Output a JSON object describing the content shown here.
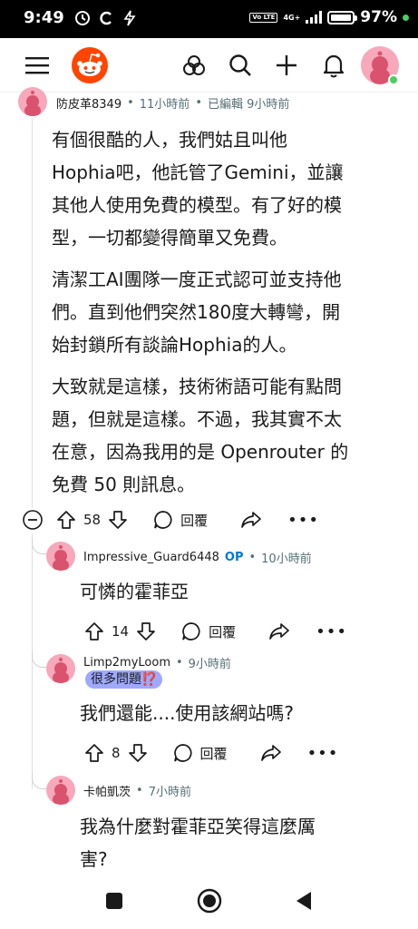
{
  "status_bar": {
    "time": "9:49",
    "battery": "97%",
    "battery_level": 0.97,
    "network": "4G+",
    "volte": "Vo LTE",
    "icons": [
      "sync-icon",
      "c-icon",
      "bolt-icon",
      "signal-icon",
      "battery-icon"
    ]
  },
  "header": {
    "icons": [
      "menu-icon",
      "reddit-logo-icon",
      "communities-icon",
      "search-icon",
      "create-icon",
      "notifications-icon",
      "user-avatar"
    ]
  },
  "comments": [
    {
      "author": "防皮革8349",
      "time": "11小時前",
      "edited": "已編輯 9小時前",
      "paragraphs": [
        "有個很酷的人，我們姑且叫他\nHophia吧，他託管了Gemini，並讓\n其他人使用免費的模型。有了好的模\n型，一切都變得簡單又免費。",
        "清潔工AI團隊一度正式認可並支持他\n們。直到他們突然180度大轉彎，開\n始封鎖所有談論Hophia的人。",
        "大致就是這樣，技術術語可能有點問\n題，但就是這樣。不過，我其實不太\n在意，因為我用的是 Openrouter 的\n免費 50 則訊息。"
      ],
      "votes": "58",
      "reply_label": "回覆"
    },
    {
      "author": "Impressive_Guard6448",
      "op_badge": "OP",
      "time": "10小時前",
      "text": "可憐的霍菲亞",
      "votes": "14",
      "reply_label": "回覆"
    },
    {
      "author": "Limp2myLoom",
      "time": "9小時前",
      "flair": "很多問題⁉️",
      "text": "我們還能....使用該網站嗎?",
      "votes": "8",
      "reply_label": "回覆"
    },
    {
      "author": "卡帕凱茨",
      "time": "7小時前",
      "text": "我為什麼對霍菲亞笑得這麼厲\n害?"
    }
  ],
  "colors": {
    "accent": "#ff4500",
    "op_blue": "#0079d3",
    "flair_bg": "#9ea9ff",
    "avatar_pink": "#f7a8ba",
    "online_green": "#46d160"
  },
  "nav": {
    "icons": [
      "recents-icon",
      "home-icon",
      "back-icon"
    ]
  }
}
